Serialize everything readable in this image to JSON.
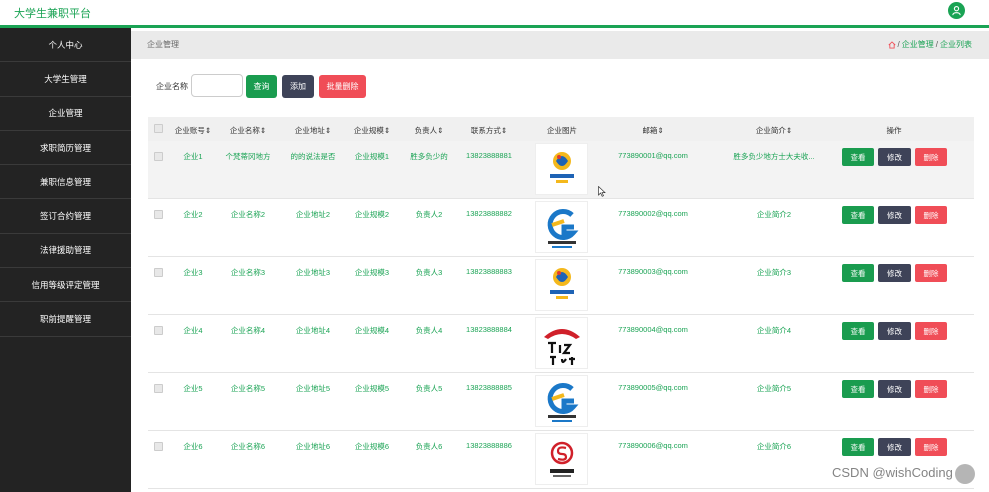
{
  "header": {
    "title": "大学生兼职平台",
    "user_icon": "user-icon"
  },
  "sidebar": {
    "items": [
      {
        "label": "个人中心"
      },
      {
        "label": "大学生管理"
      },
      {
        "label": "企业管理"
      },
      {
        "label": "求职简历管理"
      },
      {
        "label": "兼职信息管理"
      },
      {
        "label": "签订合约管理"
      },
      {
        "label": "法律援助管理"
      },
      {
        "label": "信用等级评定管理"
      },
      {
        "label": "职前提醒管理"
      }
    ]
  },
  "page": {
    "title": "企业管理",
    "breadcrumb": [
      "企业管理",
      "企业列表"
    ],
    "breadcrumb_sep": "/"
  },
  "search": {
    "label": "企业名称",
    "value": "",
    "query_label": "查询",
    "add_label": "添加",
    "bulk_delete_label": "批量删除"
  },
  "table": {
    "headers": [
      "企业账号⇕",
      "企业名称⇕",
      "企业地址⇕",
      "企业规模⇕",
      "负责人⇕",
      "联系方式⇕",
      "企业图片",
      "邮箱⇕",
      "企业简介⇕",
      "操作"
    ],
    "actions": {
      "view": "查看",
      "edit": "修改",
      "delete": "删除"
    },
    "rows": [
      {
        "account": "企业1",
        "name": "个梵蒂冈地方",
        "address": "的的说法是否",
        "scale": "企业规模1",
        "manager": "胜多负少的",
        "phone": "13823888881",
        "logo": "seafood-logo",
        "email": "773890001@qq.com",
        "intro": "胜多负少地方士大夫收..."
      },
      {
        "account": "企业2",
        "name": "企业名称2",
        "address": "企业地址2",
        "scale": "企业规模2",
        "manager": "负责人2",
        "phone": "13823888882",
        "logo": "tencent-games-logo",
        "email": "773890002@qq.com",
        "intro": "企业简介2"
      },
      {
        "account": "企业3",
        "name": "企业名称3",
        "address": "企业地址3",
        "scale": "企业规模3",
        "manager": "负责人3",
        "phone": "13823888883",
        "logo": "seafood-logo",
        "email": "773890003@qq.com",
        "intro": "企业简介3"
      },
      {
        "account": "企业4",
        "name": "企业名称4",
        "address": "企业地址4",
        "scale": "企业规模4",
        "manager": "负责人4",
        "phone": "13823888884",
        "logo": "pizza-hut-logo",
        "email": "773890004@qq.com",
        "intro": "企业简介4"
      },
      {
        "account": "企业5",
        "name": "企业名称5",
        "address": "企业地址5",
        "scale": "企业规模5",
        "manager": "负责人5",
        "phone": "13823888885",
        "logo": "tencent-games-logo",
        "email": "773890005@qq.com",
        "intro": "企业简介5"
      },
      {
        "account": "企业6",
        "name": "企业名称6",
        "address": "企业地址6",
        "scale": "企业规模6",
        "manager": "负责人6",
        "phone": "13823888886",
        "logo": "red-s-logo",
        "email": "773890006@qq.com",
        "intro": "企业简介6"
      }
    ]
  },
  "watermark": "CSDN @wishCoding",
  "colors": {
    "accent": "#1aa354",
    "sidebar": "#232323",
    "danger": "#f04d57",
    "dark": "#3e4358"
  }
}
